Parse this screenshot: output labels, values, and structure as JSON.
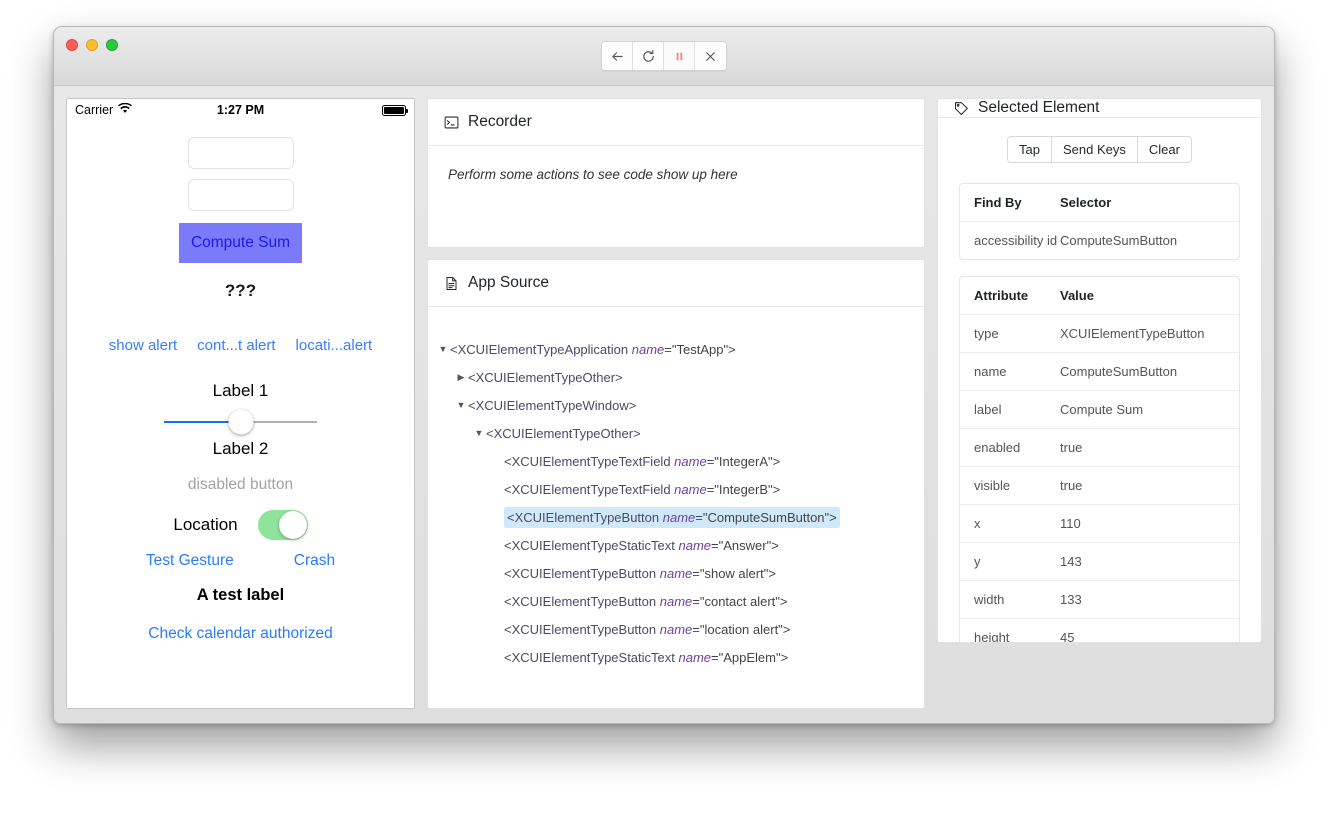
{
  "window": {
    "traffic_lights": [
      "close",
      "minimize",
      "maximize"
    ],
    "toolbar": [
      {
        "name": "back-button",
        "glyph": "←"
      },
      {
        "name": "refresh-button",
        "glyph": "⟳"
      },
      {
        "name": "pause-button",
        "glyph": "❚❚"
      },
      {
        "name": "close-session-button",
        "glyph": "✕"
      }
    ],
    "accent_pause": "#f08a87"
  },
  "simulator": {
    "status_bar": {
      "carrier": "Carrier",
      "wifi_icon": "wifi-icon",
      "time": "1:27 PM",
      "battery_icon": "battery-full-icon"
    },
    "field_a_value": "",
    "field_b_value": "",
    "field_placeholder": "",
    "compute_button": "Compute Sum",
    "compute_button_bg": "#7b7bfa",
    "compute_button_fg": "#1b1bee",
    "answer": "???",
    "alert_buttons": [
      "show alert",
      "cont...t alert",
      "locati...alert"
    ],
    "label_1": "Label 1",
    "label_2": "Label 2",
    "slider_value": 50,
    "disabled_button": "disabled button",
    "location_label": "Location",
    "location_switch_on": true,
    "switch_color": "#8fe39a",
    "test_gesture": "Test Gesture",
    "crash": "Crash",
    "a_test_label": "A test label",
    "calendar_link": "Check calendar authorized",
    "link_color": "#2b7cf7"
  },
  "recorder": {
    "title": "Recorder",
    "icon": "terminal-icon",
    "empty_message": "Perform some actions to see code show up here"
  },
  "app_source": {
    "title": "App Source",
    "icon": "document-icon",
    "tree": [
      {
        "indent": 0,
        "caret": "down",
        "tag": "XCUIElementTypeApplication",
        "attr": "name",
        "value": "TestApp",
        "selected": false
      },
      {
        "indent": 1,
        "caret": "right",
        "tag": "XCUIElementTypeOther",
        "attr": "",
        "value": "",
        "selected": false
      },
      {
        "indent": 1,
        "caret": "down",
        "tag": "XCUIElementTypeWindow",
        "attr": "",
        "value": "",
        "selected": false
      },
      {
        "indent": 2,
        "caret": "down",
        "tag": "XCUIElementTypeOther",
        "attr": "",
        "value": "",
        "selected": false
      },
      {
        "indent": 3,
        "caret": "none",
        "tag": "XCUIElementTypeTextField",
        "attr": "name",
        "value": "IntegerA",
        "selected": false
      },
      {
        "indent": 3,
        "caret": "none",
        "tag": "XCUIElementTypeTextField",
        "attr": "name",
        "value": "IntegerB",
        "selected": false
      },
      {
        "indent": 3,
        "caret": "none",
        "tag": "XCUIElementTypeButton",
        "attr": "name",
        "value": "ComputeSumButton",
        "selected": true
      },
      {
        "indent": 3,
        "caret": "none",
        "tag": "XCUIElementTypeStaticText",
        "attr": "name",
        "value": "Answer",
        "selected": false
      },
      {
        "indent": 3,
        "caret": "none",
        "tag": "XCUIElementTypeButton",
        "attr": "name",
        "value": "show alert",
        "selected": false
      },
      {
        "indent": 3,
        "caret": "none",
        "tag": "XCUIElementTypeButton",
        "attr": "name",
        "value": "contact alert",
        "selected": false
      },
      {
        "indent": 3,
        "caret": "none",
        "tag": "XCUIElementTypeButton",
        "attr": "name",
        "value": "location alert",
        "selected": false
      },
      {
        "indent": 3,
        "caret": "none",
        "tag": "XCUIElementTypeStaticText",
        "attr": "name",
        "value": "AppElem",
        "selected": false
      }
    ],
    "highlight_color": "#cfe8fa"
  },
  "selected_element": {
    "title": "Selected Element",
    "icon": "tag-icon",
    "actions": [
      "Tap",
      "Send Keys",
      "Clear"
    ],
    "locator_table": {
      "headers": [
        "Find By",
        "Selector"
      ],
      "rows": [
        [
          "accessibility id",
          "ComputeSumButton"
        ]
      ]
    },
    "attribute_table": {
      "headers": [
        "Attribute",
        "Value"
      ],
      "rows": [
        [
          "type",
          "XCUIElementTypeButton"
        ],
        [
          "name",
          "ComputeSumButton"
        ],
        [
          "label",
          "Compute Sum"
        ],
        [
          "enabled",
          "true"
        ],
        [
          "visible",
          "true"
        ],
        [
          "x",
          "110"
        ],
        [
          "y",
          "143"
        ],
        [
          "width",
          "133"
        ],
        [
          "height",
          "45"
        ]
      ]
    }
  }
}
